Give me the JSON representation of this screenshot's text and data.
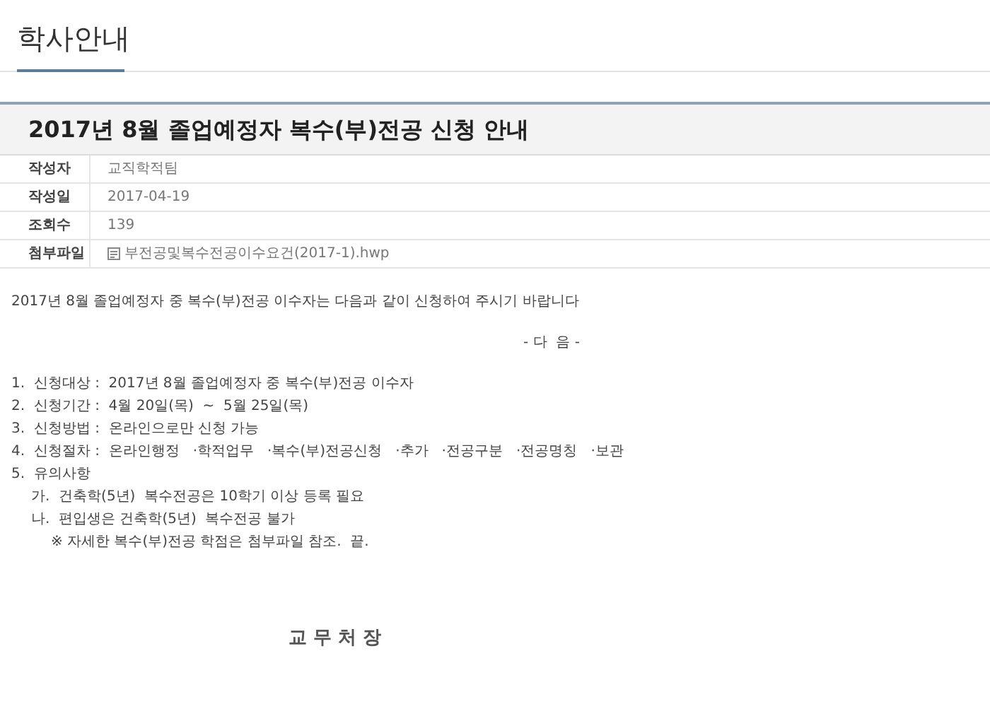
{
  "page_title": "학사안내",
  "article": {
    "title": "2017년 8월 졸업예정자 복수(부)전공 신청 안내",
    "meta": [
      {
        "label": "작성자",
        "value": "교직학적팀",
        "kind": "text"
      },
      {
        "label": "작성일",
        "value": "2017-04-19",
        "kind": "text"
      },
      {
        "label": "조회수",
        "value": "139",
        "kind": "text"
      },
      {
        "label": "첨부파일",
        "value": "부전공및복수전공이수요건(2017-1).hwp",
        "kind": "file"
      }
    ],
    "intro": "2017년 8월 졸업예정자 중 복수(부)전공 이수자는 다음과 같이 신청하여 주시기 바랍니다",
    "heading": "- 다  음 -",
    "items": [
      {
        "text": "1.  신청대상 :  2017년 8월 졸업예정자 중 복수(부)전공 이수자"
      },
      {
        "text": "2.  신청기간 :  4월 20일(목)  ~  5월 25일(목)"
      },
      {
        "text": "3.  신청방법 :  온라인으로만 신청 가능"
      },
      {
        "text": "4.  신청절차 :  온라인행정   ·학적업무   ·복수(부)전공신청   ·추가   ·전공구분   ·전공명칭   ·보관"
      },
      {
        "text": "5.  유의사항",
        "children": [
          {
            "kind": "sub",
            "text": "가.  건축학(5년)  복수전공은 10학기 이상 등록 필요"
          },
          {
            "kind": "sub",
            "text": "나.  편입생은 건축학(5년)  복수전공 불가"
          },
          {
            "kind": "note",
            "text": "※ 자세한 복수(부)전공 학점은 첨부파일 참조.  끝."
          }
        ]
      }
    ],
    "signature": "교 무 처 장"
  }
}
